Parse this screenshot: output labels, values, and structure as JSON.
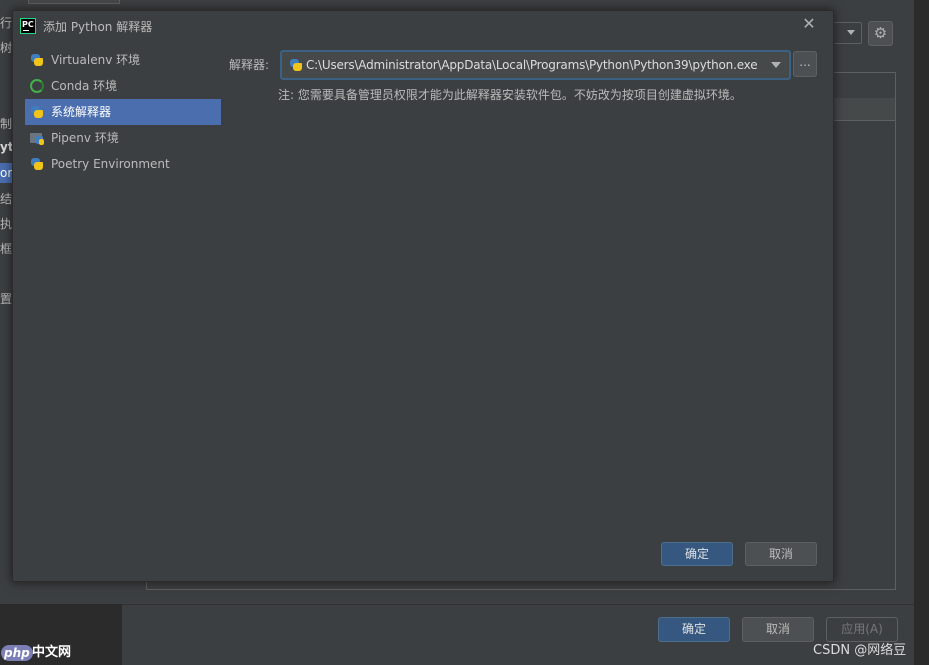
{
  "background_window": {
    "sidebar_fragments": [
      "行",
      "树",
      "制",
      "yt",
      "or",
      "结",
      "执",
      "框",
      "置"
    ],
    "footer_buttons": {
      "ok": "确定",
      "cancel": "取消",
      "apply": "应用(A)"
    },
    "gear_icon": "gear-icon"
  },
  "dialog": {
    "app_icon": {
      "label": "PC"
    },
    "title": "添加 Python 解释器",
    "nav_items": [
      {
        "label": "Virtualenv 环境",
        "icon": "python-icon"
      },
      {
        "label": "Conda 环境",
        "icon": "conda-icon"
      },
      {
        "label": "系统解释器",
        "icon": "python-icon",
        "selected": true
      },
      {
        "label": "Pipenv 环境",
        "icon": "pipenv-icon"
      },
      {
        "label": "Poetry Environment",
        "icon": "poetry-icon"
      }
    ],
    "interpreter_label": "解释器:",
    "interpreter_value": "C:\\Users\\Administrator\\AppData\\Local\\Programs\\Python\\Python39\\python.exe",
    "browse_label": "...",
    "note": "注: 您需要具备管理员权限才能为此解释器安装软件包。不妨改为按项目创建虚拟环境。",
    "ok_label": "确定",
    "cancel_label": "取消"
  },
  "watermarks": {
    "php_badge": "php",
    "php_site": "中文网",
    "csdn": "CSDN @网络豆"
  },
  "colors": {
    "accent_selection": "#4b6eaf",
    "primary_button": "#365880",
    "background": "#3c3f41"
  }
}
